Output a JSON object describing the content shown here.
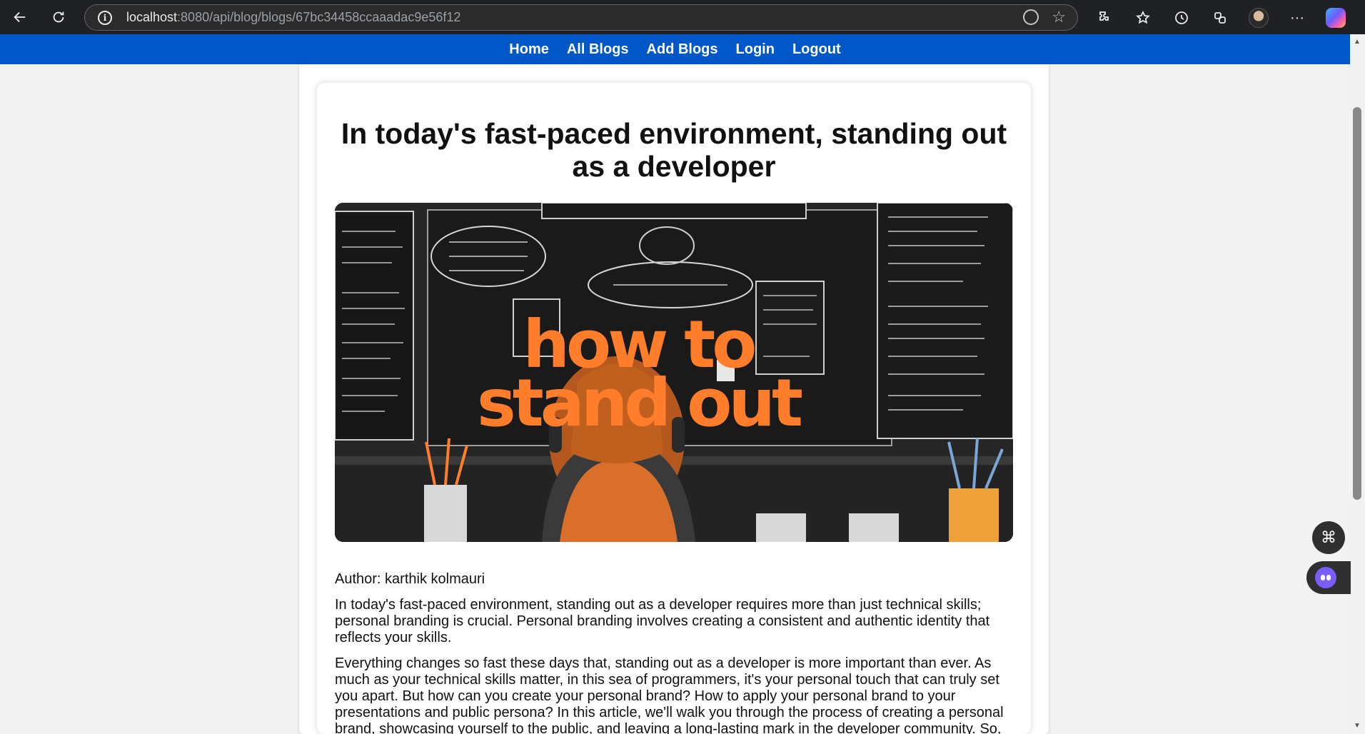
{
  "browser": {
    "url_host": "localhost",
    "url_rest": ":8080/api/blog/blogs/67bc34458ccaaadac9e56f12"
  },
  "nav": {
    "items": [
      {
        "label": "Home"
      },
      {
        "label": "All Blogs"
      },
      {
        "label": "Add Blogs"
      },
      {
        "label": "Login"
      },
      {
        "label": "Logout"
      }
    ]
  },
  "post": {
    "title": "In today's fast-paced environment, standing out as a developer",
    "image_text_line1": "how to",
    "image_text_line2": "stand out",
    "author": "Author: karthik kolmauri",
    "paragraphs": [
      "In today's fast-paced environment, standing out as a developer requires more than just technical skills; personal branding is crucial. Personal branding involves creating a consistent and authentic identity that reflects your skills.",
      "Everything changes so fast these days that, standing out as a developer is more important than ever. As much as your technical skills matter, in this sea of programmers, it's your personal touch that can truly set you apart. But how can you create your personal brand? How to apply your personal brand to your presentations and public persona? In this article, we'll walk you through the process of creating a personal brand, showcasing yourself to the public, and leaving a long-lasting mark in the developer community. So,"
    ]
  },
  "colors": {
    "nav_bg": "#0057c8",
    "accent_orange": "#ff7d2b",
    "chrome_bg": "#202124"
  }
}
